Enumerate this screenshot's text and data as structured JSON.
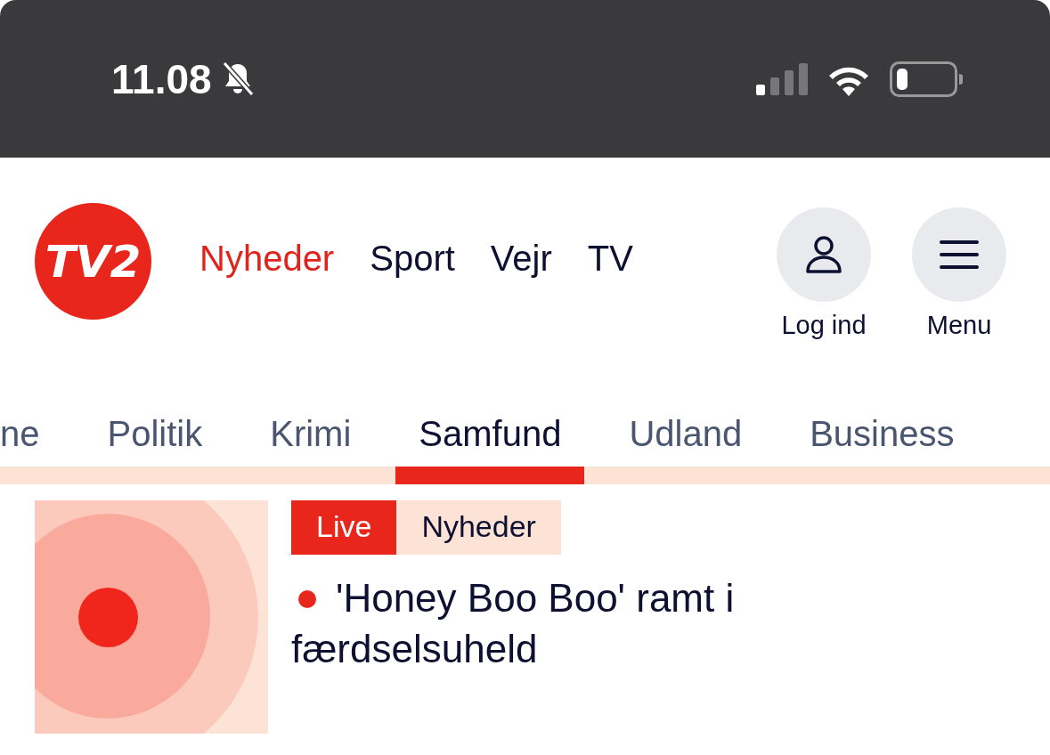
{
  "status_bar": {
    "time": "11.08",
    "silent": true
  },
  "header": {
    "logo": "TV2",
    "nav": [
      {
        "label": "Nyheder",
        "selected": true
      },
      {
        "label": "Sport",
        "selected": false
      },
      {
        "label": "Vejr",
        "selected": false
      },
      {
        "label": "TV",
        "selected": false
      }
    ],
    "actions": [
      {
        "label": "Log ind",
        "kind": "user"
      },
      {
        "label": "Menu",
        "kind": "menu"
      }
    ]
  },
  "categories": [
    {
      "label": "ne",
      "selected": false
    },
    {
      "label": "Politik",
      "selected": false
    },
    {
      "label": "Krimi",
      "selected": false
    },
    {
      "label": "Samfund",
      "selected": true
    },
    {
      "label": "Udland",
      "selected": false
    },
    {
      "label": "Business",
      "selected": false
    }
  ],
  "article": {
    "tags": [
      {
        "label": "Live",
        "kind": "live"
      },
      {
        "label": "Nyheder",
        "kind": "section"
      }
    ],
    "live": true,
    "headline": "'Honey Boo Boo' ramt i færdselsuheld"
  }
}
